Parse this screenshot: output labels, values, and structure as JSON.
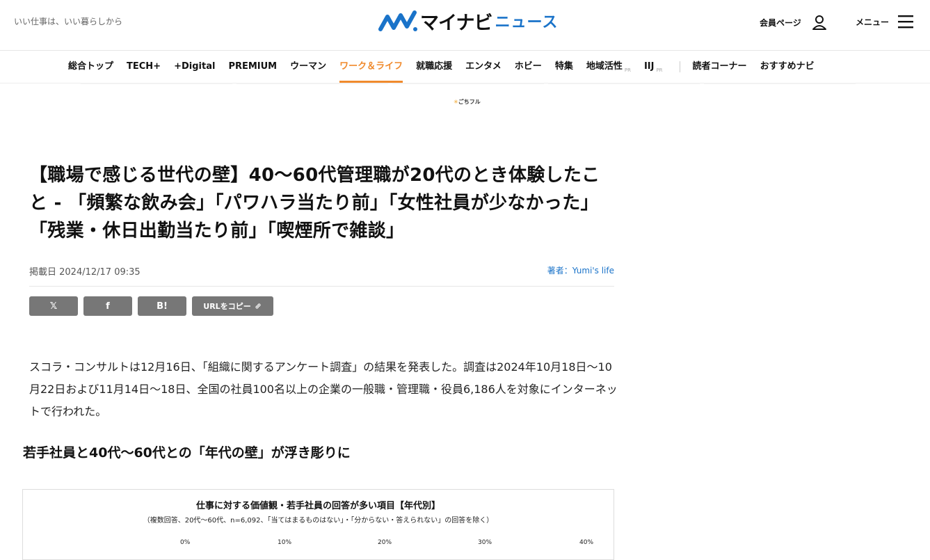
{
  "header": {
    "tagline": "いい仕事は、いい暮らしから",
    "logo_text": "マイナビ",
    "logo_news": "ニュース",
    "member_label": "会員ページ",
    "menu_label": "メニュー"
  },
  "nav": {
    "items": [
      {
        "label": "総合トップ"
      },
      {
        "label": "TECH+"
      },
      {
        "label": "+Digital"
      },
      {
        "label": "PREMIUM"
      },
      {
        "label": "ウーマン"
      },
      {
        "label": "ワーク＆ライフ"
      },
      {
        "label": "就職応援"
      },
      {
        "label": "エンタメ"
      },
      {
        "label": "ホビー"
      },
      {
        "label": "特集"
      },
      {
        "label": "地域活性",
        "badge": "PR"
      },
      {
        "label": "IIJ",
        "badge": "PR"
      },
      {
        "label": "読者コーナー"
      },
      {
        "label": "おすすめナビ"
      }
    ]
  },
  "sponsor": {
    "mark": "✳",
    "text": "ごちフル"
  },
  "article": {
    "title": "【職場で感じる世代の壁】40～60代管理職が20代のとき体験したこと - 「頻繁な飲み会」「パワハラ当たり前」「女性社員が少なかった」「残業・休日出勤当たり前」「喫煙所で雑談」",
    "date": "掲載日 2024/12/17 09:35",
    "author": "著者：Yumi's life",
    "share": {
      "x": "𝕏",
      "facebook": "f",
      "hatena": "B!",
      "copy_url": "URLをコピー"
    },
    "body": "スコラ・コンサルトは12月16日、「組織に関するアンケート調査」の結果を発表した。調査は2024年10月18日～10月22日および11月14日～18日、全国の社員100名以上の企業の一般職・管理職・役員6,186人を対象にインターネットで行われた。",
    "subheading": "若手社員と40代～60代との「年代の壁」が浮き彫りに"
  },
  "figure": {
    "title": "仕事に対する価値観・若手社員の回答が多い項目【年代別】",
    "subtitle": "（複数回答、20代～60代、n=6,092、「当てはまるものはない」・「分からない・答えられない」の回答を除く）",
    "ticks": [
      "0%",
      "10%",
      "20%",
      "30%",
      "40%"
    ]
  },
  "colors": {
    "accent": "#f08a2c",
    "brand_blue": "#1a73c9",
    "share_gray": "#777777"
  }
}
